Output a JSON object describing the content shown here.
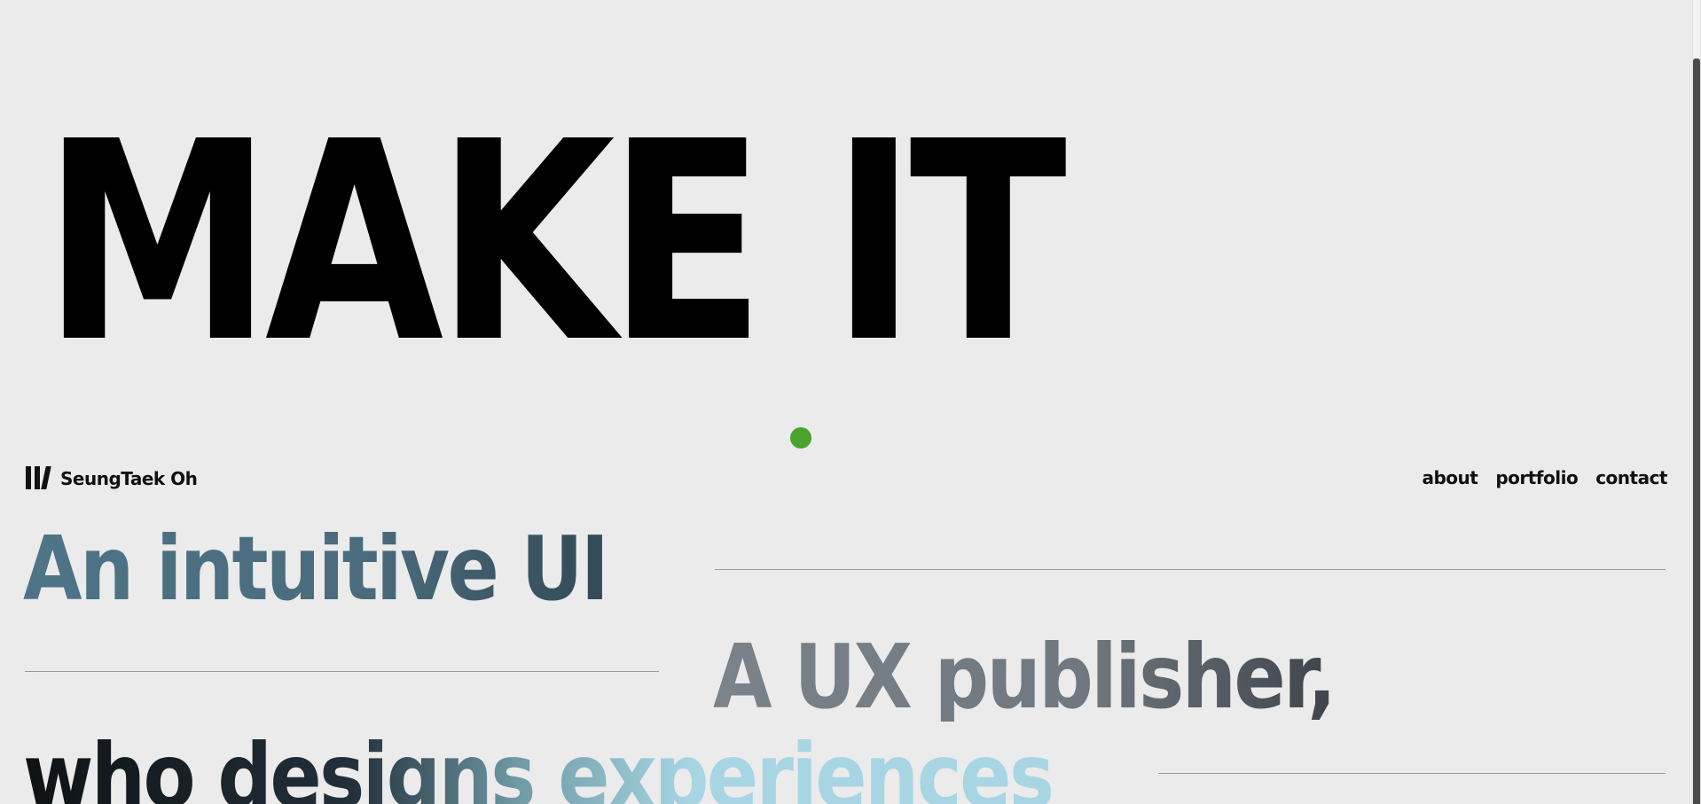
{
  "hero": {
    "headline": "MAKE IT"
  },
  "header": {
    "logo_text": "SeungTaek Oh",
    "nav": [
      {
        "label": "about"
      },
      {
        "label": "portfolio"
      },
      {
        "label": "contact"
      }
    ]
  },
  "intro": {
    "line1": "An intuitive UI",
    "line2": "A UX publisher,",
    "line3": "who designs experiences"
  },
  "colors": {
    "background": "#ebebeb",
    "dot": "#4aa32a",
    "headline": "#000000",
    "accent_blue": "#4e7487",
    "accent_gray": "#6f777f",
    "accent_light_blue": "#a7d5e3"
  }
}
